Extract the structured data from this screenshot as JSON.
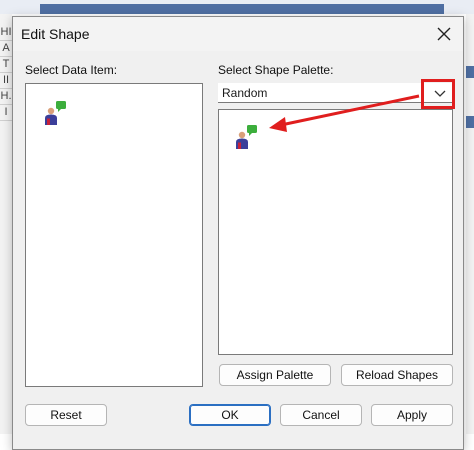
{
  "dialog": {
    "title": "Edit Shape",
    "select_data_item_label": "Select Data Item:",
    "select_shape_palette_label": "Select Shape Palette:",
    "palette_selected": "Random",
    "buttons": {
      "assign_palette": "Assign Palette",
      "reload_shapes": "Reload Shapes",
      "reset": "Reset",
      "ok": "OK",
      "cancel": "Cancel",
      "apply": "Apply"
    }
  },
  "background_app": {
    "row_labels": [
      "HI",
      "A",
      "T",
      "II",
      "H.",
      "I"
    ]
  },
  "icons": {
    "close": "close-icon",
    "chevron": "chevron-down-icon",
    "shape": "person-with-chat-icon"
  },
  "colors": {
    "annotation_red": "#e01e1e",
    "default_button_border": "#2b6fc2"
  }
}
